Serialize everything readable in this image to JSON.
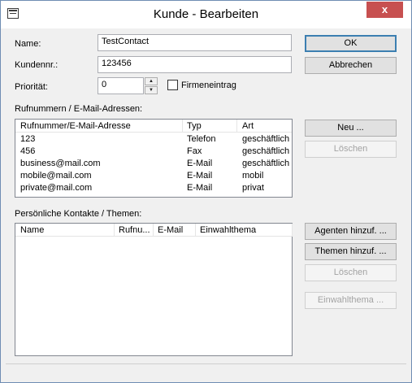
{
  "window": {
    "title": "Kunde - Bearbeiten",
    "close_label": "x"
  },
  "form": {
    "name_label": "Name:",
    "name_value": "TestContact",
    "kundennr_label": "Kundennr.:",
    "kundennr_value": "123456",
    "prioritaet_label": "Priorität:",
    "prioritaet_value": "0",
    "firmeneintrag_label": "Firmeneintrag"
  },
  "buttons": {
    "ok": "OK",
    "abbrechen": "Abbrechen",
    "neu": "Neu ...",
    "loeschen1": "Löschen",
    "agenten": "Agenten hinzuf. ...",
    "themen": "Themen hinzuf. ...",
    "loeschen2": "Löschen",
    "einwahlthema": "Einwahlthema ..."
  },
  "phones": {
    "section_label": "Rufnummern / E-Mail-Adressen:",
    "headers": [
      "Rufnummer/E-Mail-Adresse",
      "Typ",
      "Art"
    ],
    "rows": [
      [
        "123",
        "Telefon",
        "geschäftlich"
      ],
      [
        "456",
        "Fax",
        "geschäftlich"
      ],
      [
        "business@mail.com",
        "E-Mail",
        "geschäftlich"
      ],
      [
        "mobile@mail.com",
        "E-Mail",
        "mobil"
      ],
      [
        "private@mail.com",
        "E-Mail",
        "privat"
      ]
    ]
  },
  "contacts": {
    "section_label": "Persönliche Kontakte / Themen:",
    "headers": [
      "Name",
      "Rufnu...",
      "E-Mail",
      "Einwahlthema"
    ]
  }
}
